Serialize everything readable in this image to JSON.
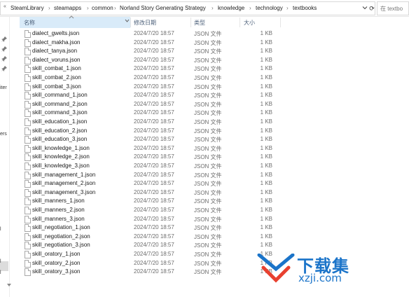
{
  "address_bar": {
    "nav_arrows": "«",
    "crumbs": [
      "SteamLibrary",
      "steamapps",
      "common",
      "Norland Story Generating Strategy",
      "knowledge",
      "technology",
      "textbooks"
    ],
    "separator": "›",
    "dropdown_icon": "chevron-down-icon",
    "refresh_glyph": "⟳"
  },
  "search": {
    "placeholder": "在 textbo"
  },
  "nav_pane": {
    "fragments": [
      "iter",
      "ers",
      "l",
      "l",
      "l"
    ]
  },
  "columns": {
    "name": "名称",
    "modified": "修改日期",
    "type": "类型",
    "size": "大小"
  },
  "files": [
    {
      "name": "dialect_gwelts.json",
      "date": "2024/7/20 18:57",
      "type": "JSON 文件",
      "size": "1 KB"
    },
    {
      "name": "dialect_makha.json",
      "date": "2024/7/20 18:57",
      "type": "JSON 文件",
      "size": "1 KB"
    },
    {
      "name": "dialect_tanya.json",
      "date": "2024/7/20 18:57",
      "type": "JSON 文件",
      "size": "1 KB"
    },
    {
      "name": "dialect_voruns.json",
      "date": "2024/7/20 18:57",
      "type": "JSON 文件",
      "size": "1 KB"
    },
    {
      "name": "skill_combat_1.json",
      "date": "2024/7/20 18:57",
      "type": "JSON 文件",
      "size": "1 KB"
    },
    {
      "name": "skill_combat_2.json",
      "date": "2024/7/20 18:57",
      "type": "JSON 文件",
      "size": "1 KB"
    },
    {
      "name": "skill_combat_3.json",
      "date": "2024/7/20 18:57",
      "type": "JSON 文件",
      "size": "1 KB"
    },
    {
      "name": "skill_command_1.json",
      "date": "2024/7/20 18:57",
      "type": "JSON 文件",
      "size": "1 KB"
    },
    {
      "name": "skill_command_2.json",
      "date": "2024/7/20 18:57",
      "type": "JSON 文件",
      "size": "1 KB"
    },
    {
      "name": "skill_command_3.json",
      "date": "2024/7/20 18:57",
      "type": "JSON 文件",
      "size": "1 KB"
    },
    {
      "name": "skill_education_1.json",
      "date": "2024/7/20 18:57",
      "type": "JSON 文件",
      "size": "1 KB"
    },
    {
      "name": "skill_education_2.json",
      "date": "2024/7/20 18:57",
      "type": "JSON 文件",
      "size": "1 KB"
    },
    {
      "name": "skill_education_3.json",
      "date": "2024/7/20 18:57",
      "type": "JSON 文件",
      "size": "1 KB"
    },
    {
      "name": "skill_knowledge_1.json",
      "date": "2024/7/20 18:57",
      "type": "JSON 文件",
      "size": "1 KB"
    },
    {
      "name": "skill_knowledge_2.json",
      "date": "2024/7/20 18:57",
      "type": "JSON 文件",
      "size": "1 KB"
    },
    {
      "name": "skill_knowledge_3.json",
      "date": "2024/7/20 18:57",
      "type": "JSON 文件",
      "size": "1 KB"
    },
    {
      "name": "skill_management_1.json",
      "date": "2024/7/20 18:57",
      "type": "JSON 文件",
      "size": "1 KB"
    },
    {
      "name": "skill_management_2.json",
      "date": "2024/7/20 18:57",
      "type": "JSON 文件",
      "size": "1 KB"
    },
    {
      "name": "skill_management_3.json",
      "date": "2024/7/20 18:57",
      "type": "JSON 文件",
      "size": "1 KB"
    },
    {
      "name": "skill_manners_1.json",
      "date": "2024/7/20 18:57",
      "type": "JSON 文件",
      "size": "1 KB"
    },
    {
      "name": "skill_manners_2.json",
      "date": "2024/7/20 18:57",
      "type": "JSON 文件",
      "size": "1 KB"
    },
    {
      "name": "skill_manners_3.json",
      "date": "2024/7/20 18:57",
      "type": "JSON 文件",
      "size": "1 KB"
    },
    {
      "name": "skill_negotiation_1.json",
      "date": "2024/7/20 18:57",
      "type": "JSON 文件",
      "size": "1 KB"
    },
    {
      "name": "skill_negotiation_2.json",
      "date": "2024/7/20 18:57",
      "type": "JSON 文件",
      "size": "1 KB"
    },
    {
      "name": "skill_negotiation_3.json",
      "date": "2024/7/20 18:57",
      "type": "JSON 文件",
      "size": "1 KB"
    },
    {
      "name": "skill_oratory_1.json",
      "date": "2024/7/20 18:57",
      "type": "JSON 文件",
      "size": "1 KB"
    },
    {
      "name": "skill_oratory_2.json",
      "date": "2024/7/20 18:57",
      "type": "JSON 文件",
      "size": "1 KB"
    },
    {
      "name": "skill_oratory_3.json",
      "date": "2024/7/20 18:57",
      "type": "JSON 文件",
      "size": "1 KB"
    }
  ],
  "watermark": {
    "title": "下载集",
    "url": "xzji.com",
    "color": "#1b74c9"
  },
  "colors": {
    "header_selected": "#d9ebf9",
    "header_text": "#4c607a",
    "secondary_text": "#6d6d6d"
  }
}
